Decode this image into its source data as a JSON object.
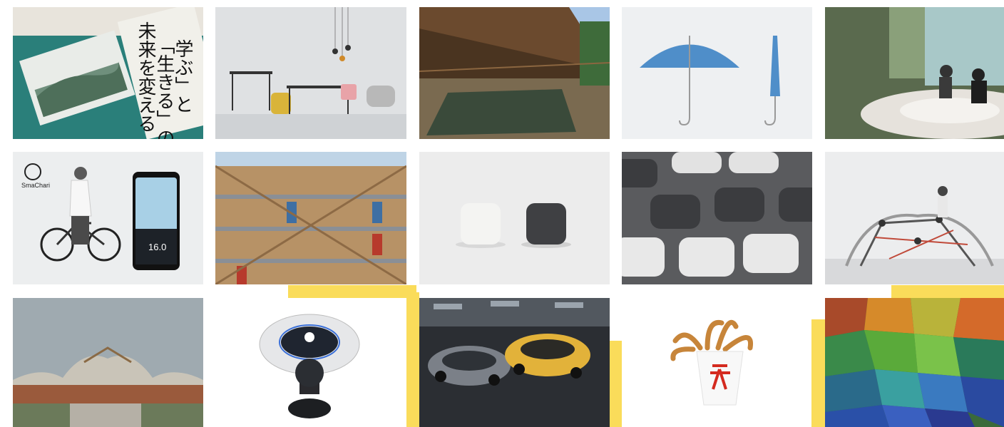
{
  "gallery": {
    "tiles": [
      {
        "row": 1,
        "col": 1,
        "subject": "green-pamphlets"
      },
      {
        "row": 1,
        "col": 2,
        "subject": "furniture-set"
      },
      {
        "row": 1,
        "col": 3,
        "subject": "wooden-corridor-building"
      },
      {
        "row": 1,
        "col": 4,
        "subject": "blue-umbrella"
      },
      {
        "row": 1,
        "col": 5,
        "subject": "textile-art-installation"
      },
      {
        "row": 2,
        "col": 1,
        "subject": "smachari-bicycle-app"
      },
      {
        "row": 2,
        "col": 2,
        "subject": "timber-frame-apartment"
      },
      {
        "row": 2,
        "col": 3,
        "subject": "rice-cookers"
      },
      {
        "row": 2,
        "col": 4,
        "subject": "keypad-devices"
      },
      {
        "row": 2,
        "col": 5,
        "subject": "playground-climbing-frame"
      },
      {
        "row": 3,
        "col": 1,
        "subject": "wave-roof-building"
      },
      {
        "row": 3,
        "col": 2,
        "subject": "access-controller"
      },
      {
        "row": 3,
        "col": 3,
        "subject": "sports-cars"
      },
      {
        "row": 3,
        "col": 4,
        "subject": "tempura-snack"
      },
      {
        "row": 3,
        "col": 5,
        "subject": "mosaic-glass"
      }
    ],
    "pamphlet_text": {
      "line1": "未来を変える",
      "line2": "「生きる」の",
      "line3": "学ぶ」と"
    },
    "smachari": {
      "logo_text": "SmaChari",
      "speed": "16.0"
    },
    "colors": {
      "accent_yellow": "#fadc5a",
      "pamphlet_green": "#2a7f7a"
    }
  }
}
